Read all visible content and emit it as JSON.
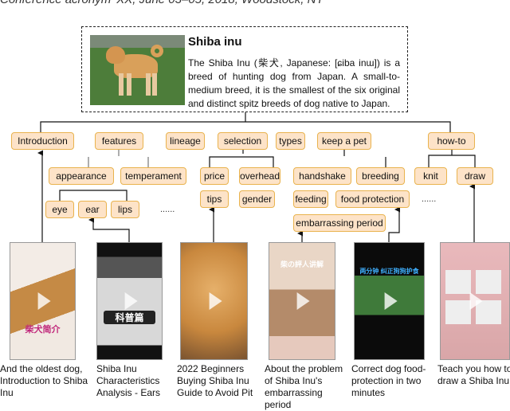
{
  "header": "Conference acronym 'XX, June 03–05, 2018, Woodstock, NY",
  "root": {
    "title": "Shiba inu",
    "description": "The Shiba Inu (柴犬, Japanese: [ɕiba inɯ]) is a breed of hunting dog from Japan. A small-to-medium breed, it is the smallest of the six original and distinct spitz breeds of dog native to Japan."
  },
  "nodes": {
    "introduction": "Introduction",
    "features": "features",
    "lineage": "lineage",
    "selection": "selection",
    "types": "types",
    "keep_a_pet": "keep a pet",
    "how_to": "how-to",
    "appearance": "appearance",
    "temperament": "temperament",
    "price": "price",
    "overhead": "overhead",
    "tips": "tips",
    "gender": "gender",
    "handshake": "handshake",
    "breeding": "breeding",
    "feeding": "feeding",
    "food_protection": "food protection",
    "embarrassing_period": "embarrassing period",
    "knit": "knit",
    "draw": "draw",
    "eye": "eye",
    "ear": "ear",
    "lips": "lips",
    "ellipsis": "......"
  },
  "videos": [
    {
      "caption": "And the oldest dog, Introduction to Shiba Inu",
      "overlay": "柴犬简介",
      "colors": [
        "#f3ece6",
        "#c58a45"
      ]
    },
    {
      "caption": "Shiba Inu Characteristics Analysis - Ears",
      "overlay": "科普篇",
      "colors": [
        "#111111",
        "#d8d8d8"
      ]
    },
    {
      "caption": "2022 Beginners Buying Shiba Inu Guide to Avoid Pit",
      "overlay": "",
      "colors": [
        "#c9883e",
        "#e6b06a"
      ]
    },
    {
      "caption": "About the problem of Shiba Inu's embarrassing period",
      "overlay": "柴の評人讲解",
      "colors": [
        "#e9d6c6",
        "#b48b6a"
      ]
    },
    {
      "caption": "Correct dog food-protection in two minutes",
      "overlay": "两分钟 纠正狗狗护食",
      "colors": [
        "#0b0b0b",
        "#3f7a3a"
      ]
    },
    {
      "caption": "Teach you how to draw a Shiba Inu",
      "overlay": "",
      "colors": [
        "#e9b9bc",
        "#d9a6a8"
      ]
    }
  ]
}
